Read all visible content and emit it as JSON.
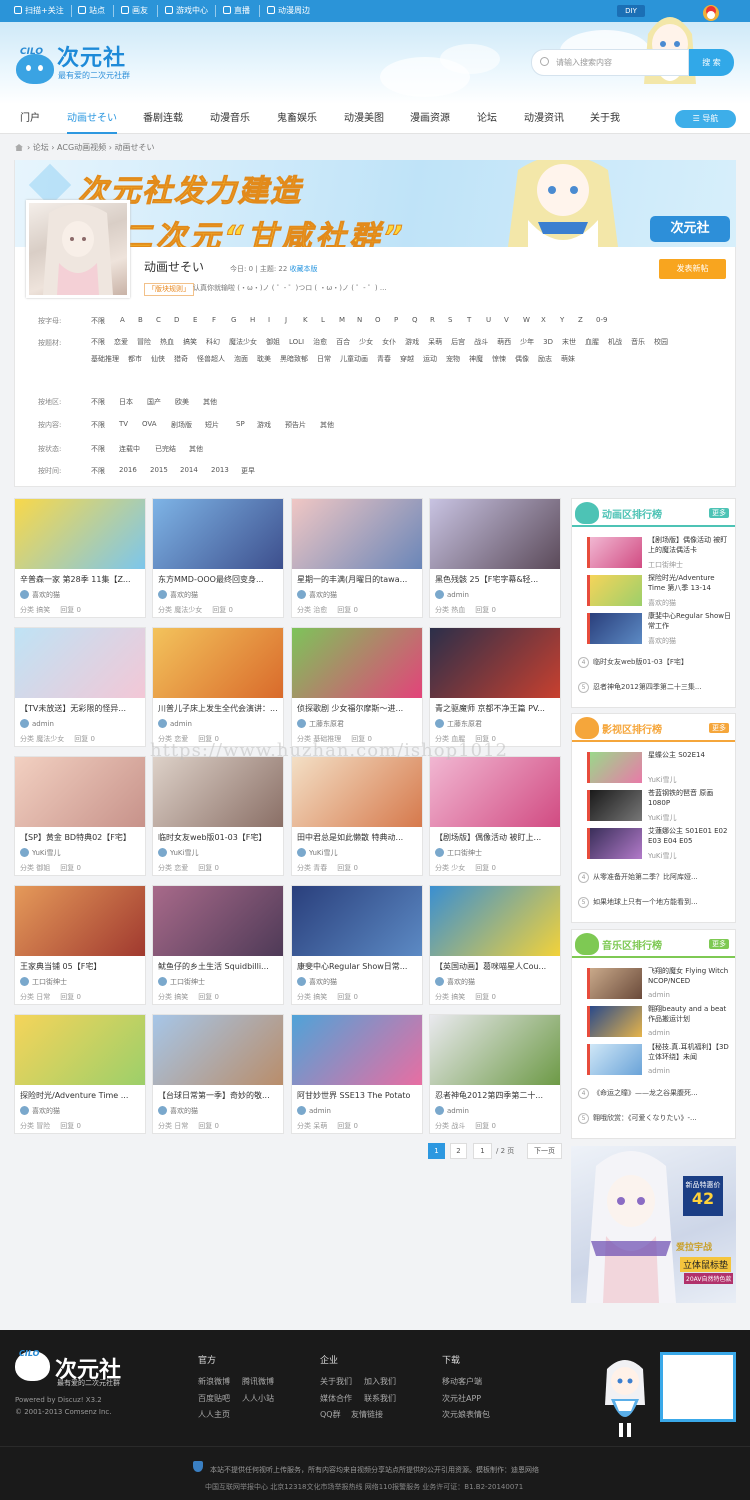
{
  "topbar": {
    "items": [
      "扫描+关注",
      "站点",
      "画友",
      "游戏中心",
      "直播",
      "动漫周边"
    ],
    "diy": "DIY"
  },
  "header": {
    "logo_badge": "CILO",
    "logo_name": "次元社",
    "logo_slogan": "最有爱的二次元社群",
    "search_placeholder": "请输入搜索内容",
    "search_button": "搜 索"
  },
  "nav": {
    "items": [
      "门户",
      "动画せそい",
      "番剧连载",
      "动漫音乐",
      "鬼畜娱乐",
      "动漫美图",
      "漫画资源",
      "论坛",
      "动漫资讯",
      "关于我"
    ],
    "active": "动画せそい",
    "guide": "导航"
  },
  "breadcrumb": {
    "items": [
      "论坛",
      "ACG动画视频",
      "动画せそい"
    ],
    "sep": "›"
  },
  "banner": {
    "line1": "次元社发力建造",
    "line2": "二次元“甘咸社群”",
    "logo": "次元社"
  },
  "forum": {
    "name": "动画せそい",
    "stats": "今日: 0  |  主题: 22  ",
    "fav": "收藏本版",
    "rules_tag": "「版块规则」",
    "rules_text": "认真你就输啦 (・ω・)ノ ( ゜- ゜)つロ ( ・ω・)ノ ( ゜- ゜) ...",
    "post_button": "发表新帖"
  },
  "filters": {
    "letter_label": "按字母:",
    "letters": [
      "不限",
      "A",
      "B",
      "C",
      "D",
      "E",
      "F",
      "G",
      "H",
      "I",
      "J",
      "K",
      "L",
      "M",
      "N",
      "O",
      "P",
      "Q",
      "R",
      "S",
      "T",
      "U",
      "V",
      "W",
      "X",
      "Y",
      "Z",
      "0-9"
    ],
    "tag_label": "按题材:",
    "tags": [
      "不限",
      "恋爱",
      "冒险",
      "热血",
      "搞笑",
      "科幻",
      "魔法少女",
      "御姐",
      "LOLI",
      "治愈",
      "百合",
      "少女",
      "女仆",
      "游戏",
      "呆萌",
      "后宫",
      "战斗",
      "萌西",
      "少年",
      "3D",
      "末世",
      "血腥",
      "机战",
      "音乐",
      "校园",
      "基础推理",
      "都市",
      "仙侠",
      "猎奇",
      "怪兽超人",
      "泡面",
      "耽美",
      "黑暗致郁",
      "日常",
      "儿童动画",
      "青春",
      "穿越",
      "运动",
      "宠物",
      "神魔",
      "惊悚",
      "偶像",
      "励志",
      "萌妹"
    ],
    "region_label": "按地区:",
    "regions": [
      "不限",
      "日本",
      "国产",
      "欧美",
      "其他"
    ],
    "type_label": "按内容:",
    "types": [
      "不限",
      "TV",
      "OVA",
      "剧场版",
      "短片",
      "SP",
      "游戏",
      "预告片",
      "其他"
    ],
    "status_label": "按状态:",
    "statuses": [
      "不限",
      "连载中",
      "已完结",
      "其他"
    ],
    "time_label": "按时间:",
    "times": [
      "不限",
      "2016",
      "2015",
      "2014",
      "2013",
      "更早"
    ]
  },
  "cards": [
    {
      "title": "辛普森一家 第28季 11集【Z...",
      "author": "喜欢的猫",
      "cat": "分类 搞笑",
      "reply": "回复 0",
      "c1": "#f8d84a",
      "c2": "#7cc6ec"
    },
    {
      "title": "东方MMD-OOO最终回变身...",
      "author": "喜欢的猫",
      "cat": "分类 魔法少女",
      "reply": "回复 0",
      "c1": "#7eb4e6",
      "c2": "#3d4f8d"
    },
    {
      "title": "星期一的丰满(月曜日的tawa...",
      "author": "喜欢的猫",
      "cat": "分类 治愈",
      "reply": "回复 0",
      "c1": "#f0c7c4",
      "c2": "#6a86b8"
    },
    {
      "title": "黑色残骸 25【F宅字幕&轻...",
      "author": "admin",
      "cat": "分类 热血",
      "reply": "回复 0",
      "c1": "#c8c3e2",
      "c2": "#5b4a59"
    },
    {
      "title": "【TV未放送】无彩限的怪异...",
      "author": "admin",
      "cat": "分类 魔法少女",
      "reply": "回复 0",
      "c1": "#bfe3f5",
      "c2": "#f3c7d6"
    },
    {
      "title": "川普儿子床上发生全代会演讲：...",
      "author": "admin",
      "cat": "分类 恋爱",
      "reply": "回复 0",
      "c1": "#f3c35c",
      "c2": "#d96a2b"
    },
    {
      "title": "侦探歌剧 少女福尔摩斯～进...",
      "author": "工藤东原君",
      "cat": "分类 基础推理",
      "reply": "回复 0",
      "c1": "#7dc45a",
      "c2": "#e3437a"
    },
    {
      "title": "青之驱魔师 京都不净王篇 PV...",
      "author": "工藤东原君",
      "cat": "分类 血腥",
      "reply": "回复 0",
      "c1": "#2b2f4a",
      "c2": "#c8402f"
    },
    {
      "title": "【SP】黄金 BD特典02【F宅】",
      "author": "YuKi雪儿",
      "cat": "分类 御姐",
      "reply": "回复 0",
      "c1": "#f2d0c1",
      "c2": "#c7928a"
    },
    {
      "title": "临时女友web版01-03【F宅】",
      "author": "YuKi雪儿",
      "cat": "分类 恋爱",
      "reply": "回复 0",
      "c1": "#ddd1c8",
      "c2": "#8a6f66"
    },
    {
      "title": "田中君总是如此懒散 特典动...",
      "author": "YuKi雪儿",
      "cat": "分类 青春",
      "reply": "回复 0",
      "c1": "#f3dfc5",
      "c2": "#d6794c"
    },
    {
      "title": "【剧场版】偶像活动 被盯上...",
      "author": "工口街绅士",
      "cat": "分类 少女",
      "reply": "回复 0",
      "c1": "#f1b7d2",
      "c2": "#d14b82"
    },
    {
      "title": "王家典当铺 05【F宅】",
      "author": "工口街绅士",
      "cat": "分类 日常",
      "reply": "回复 0",
      "c1": "#e59a5a",
      "c2": "#a0392f"
    },
    {
      "title": "鱿鱼仔的乡土生活 Squidbilli...",
      "author": "工口街绅士",
      "cat": "分类 搞笑",
      "reply": "回复 0",
      "c1": "#a86a8a",
      "c2": "#4e3a57"
    },
    {
      "title": "康斐中心Regular Show日常...",
      "author": "喜欢的猫",
      "cat": "分类 搞笑",
      "reply": "回复 0",
      "c1": "#2a3f7c",
      "c2": "#5c8ac4"
    },
    {
      "title": "【英国动画】葛咪喵星人Cou...",
      "author": "喜欢的猫",
      "cat": "分类 搞笑",
      "reply": "回复 0",
      "c1": "#3a8fd1",
      "c2": "#f2d23a"
    },
    {
      "title": "探险时光/Adventure Time ...",
      "author": "喜欢的猫",
      "cat": "分类 冒险",
      "reply": "回复 0",
      "c1": "#f5d45a",
      "c2": "#9ccf6a"
    },
    {
      "title": "【台球日常第一季】奇妙的敬...",
      "author": "喜欢的猫",
      "cat": "分类 日常",
      "reply": "回复 0",
      "c1": "#a6c6e8",
      "c2": "#b98d6a"
    },
    {
      "title": "阿甘妙世界 SSE13 The Potato",
      "author": "admin",
      "cat": "分类 呆萌",
      "reply": "回复 0",
      "c1": "#4fa3d8",
      "c2": "#e86ea2"
    },
    {
      "title": "忍者神龟2012第四季第二十...",
      "author": "admin",
      "cat": "分类 战斗",
      "reply": "回复 0",
      "c1": "#e9e9ee",
      "c2": "#6d9a46"
    }
  ],
  "pagination": {
    "pages": [
      "1",
      "2"
    ],
    "current": "1",
    "input": "1",
    "total": "/ 2 页",
    "next": "下一页"
  },
  "rank_anime": {
    "title": "动画区排行榜",
    "more": "更多",
    "top": [
      {
        "title": "【剧场版】偶像活动 被盯上的魔法偶活卡",
        "author": "工口街绅士"
      },
      {
        "title": "探险时光/Adventure Time 第八季 13-14",
        "author": "喜欢的猫"
      },
      {
        "title": "康斐中心Regular Show日常工作",
        "author": "喜欢的猫"
      }
    ],
    "list": [
      {
        "n": "4",
        "title": "临时女友web版01-03【F宅】"
      },
      {
        "n": "5",
        "title": "忍者神龟2012第四季第二十三集..."
      }
    ]
  },
  "rank_film": {
    "title": "影视区排行榜",
    "more": "更多",
    "top": [
      {
        "title": "星蝶公主 S02E14",
        "author": "YuKi雪儿"
      },
      {
        "title": "苍蓝钢铁的琶音 原画1080P",
        "author": "YuKi雪儿"
      },
      {
        "title": "艾蓮娜公主 S01E01 E02 E03 E04 E05",
        "author": "YuKi雪儿"
      }
    ],
    "list": [
      {
        "n": "4",
        "title": "从零准备开始第二季？比阿库娅..."
      },
      {
        "n": "5",
        "title": "如果地球上只有一个地方能看到..."
      }
    ]
  },
  "rank_music": {
    "title": "音乐区排行榜",
    "more": "更多",
    "top": [
      {
        "title": "飞翔的魔女 Flying Witch NCOP/NCED",
        "author": "admin"
      },
      {
        "title": "翱翔beauty and a beat 作品搬运计划",
        "author": "admin"
      },
      {
        "title": "【秘技.真.耳机福利】【3D立体环绕】未闻",
        "author": "admin"
      }
    ],
    "list": [
      {
        "n": "4",
        "title": "《命运之瞳》——龙之谷果腹死..."
      },
      {
        "n": "5",
        "title": "翱哦欣赏：《可爱くなりたい》-..."
      }
    ]
  },
  "ad": {
    "badge_top": "新品特惠价",
    "badge_num": "42",
    "line1": "爱拉宇战",
    "line2": "立体鼠标垫",
    "line3": "20AV自然特色款"
  },
  "footer": {
    "logo_badge": "CILO",
    "logo_name": "次元社",
    "logo_slogan": "最有爱的二次元社群",
    "powered": "Powered by Discuz! X3.2",
    "copyright": "© 2001-2013 Comsenz Inc.",
    "col1_head": "官方",
    "col1": [
      "新浪微博",
      "腾讯微博",
      "百度贴吧",
      "人人小站",
      "人人主页"
    ],
    "col2_head": "企业",
    "col2": [
      "关于我们",
      "加入我们",
      "媒体合作",
      "联系我们",
      "QQ群",
      "友情链接"
    ],
    "col3_head": "下载",
    "col3": [
      "移动客户端",
      "次元社APP",
      "次元娘表情包"
    ],
    "notice": "本站不提供任何视听上传服务，所有内容均来自视频分享站点所提供的公开引用资源。模板制作：迪恩网络",
    "license": "中国互联网举报中心    北京12318文化市场举报热线    网络110报警服务    业务许可证：B1.B2-20140071"
  },
  "watermark": "https://www.huzhan.com/ishop1012",
  "colors": {
    "accent": "#2d98e0",
    "orange": "#f8a51f",
    "anime_rank": "#4dc3b5",
    "film_rank": "#f5a63b",
    "music_rank": "#7ec953",
    "footer_bg": "#1a1a1a"
  }
}
